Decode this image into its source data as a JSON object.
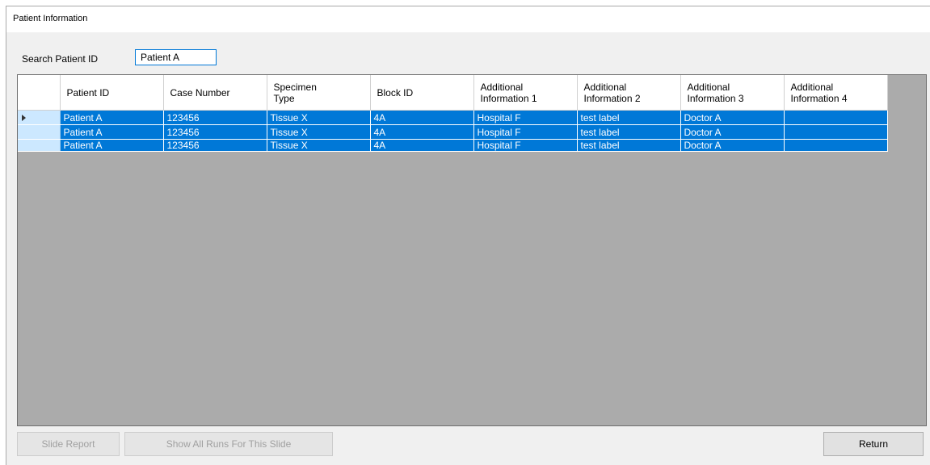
{
  "window": {
    "title": "Patient Information"
  },
  "search": {
    "label": "Search Patient ID",
    "value": "Patient A"
  },
  "grid": {
    "columns": [
      "Patient ID",
      "Case Number",
      "Specimen\nType",
      "Block ID",
      "Additional\nInformation 1",
      "Additional\nInformation 2",
      "Additional\nInformation 3",
      "Additional\nInformation 4"
    ],
    "rows": [
      [
        "Patient A",
        "123456",
        "Tissue X",
        "4A",
        "Hospital F",
        "test label",
        "Doctor A",
        ""
      ],
      [
        "Patient A",
        "123456",
        "Tissue X",
        "4A",
        "Hospital F",
        "test label",
        "Doctor A",
        ""
      ],
      [
        "Patient A",
        "123456",
        "Tissue X",
        "4A",
        "Hospital F",
        "test label",
        "Doctor A",
        ""
      ]
    ],
    "selection_color": "#0078d7",
    "current_row_icon": "right-triangle-icon"
  },
  "buttons": {
    "slide_report": "Slide Report",
    "show_all_runs": "Show All Runs For This Slide",
    "return": "Return"
  }
}
